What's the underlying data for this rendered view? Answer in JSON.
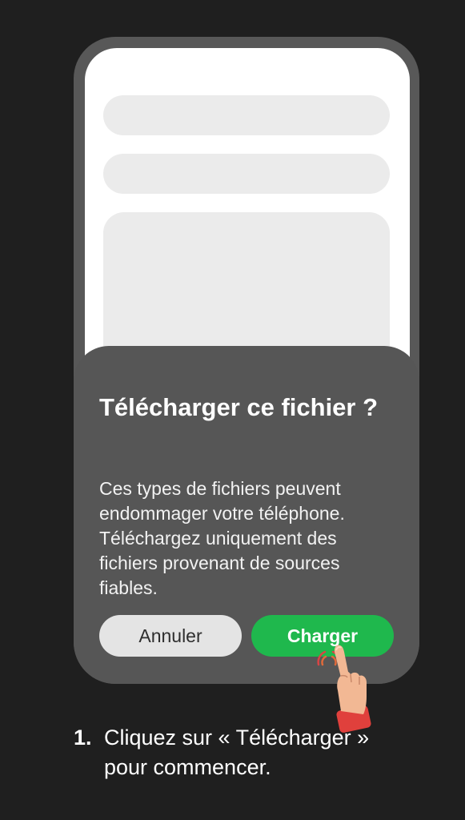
{
  "dialog": {
    "title": "Télécharger ce fichier ?",
    "message": "Ces types de fichiers peuvent endommager votre téléphone. Téléchargez uniquement des fichiers provenant de sources fiables.",
    "cancel_label": "Annuler",
    "confirm_label": "Charger"
  },
  "instruction": {
    "step_number": "1.",
    "text": "Cliquez sur « Télécharger » pour commencer."
  },
  "icons": {
    "pointer": "hand-pointer-icon",
    "tap": "tap-ripple-icon"
  },
  "colors": {
    "background": "#1f1f1f",
    "sheet": "#565656",
    "confirm": "#1fb84d",
    "cancel": "#e4e4e4"
  }
}
